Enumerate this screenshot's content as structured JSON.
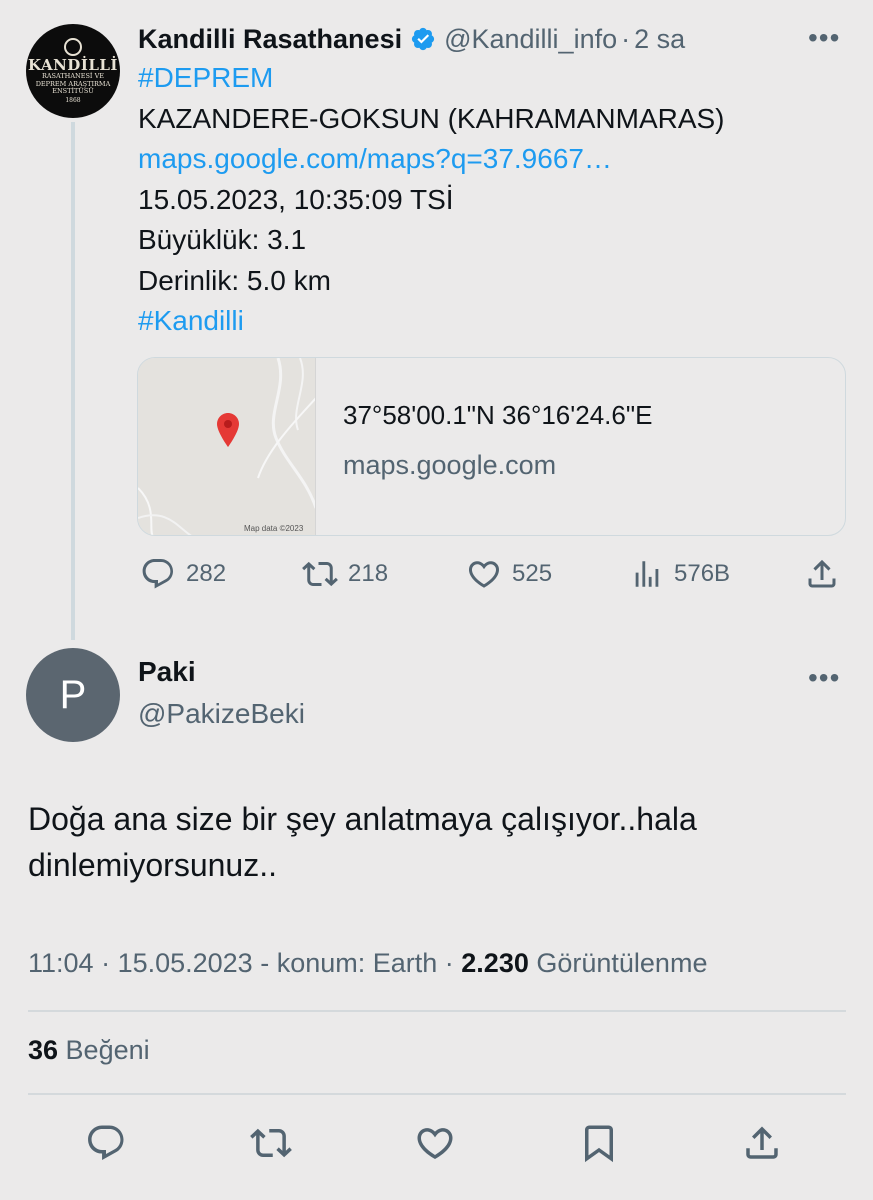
{
  "parent_tweet": {
    "author_name": "Kandilli Rasathanesi",
    "author_handle": "@Kandilli_info",
    "separator": "·",
    "time_ago": "2 sa",
    "more": "•••",
    "avatar": {
      "brand": "KANDİLLİ",
      "line1": "RASATHANESİ VE",
      "line2": "DEPREM ARAŞTIRMA",
      "line3": "ENSTİTÜSÜ",
      "year": "1868"
    },
    "lines": {
      "hashtag1": "#DEPREM",
      "location": "KAZANDERE-GOKSUN (KAHRAMANMARAS)",
      "link": "maps.google.com/maps?q=37.9667…",
      "datetime": "15.05.2023, 10:35:09 TSİ",
      "magnitude": "Büyüklük: 3.1",
      "depth": "Derinlik: 5.0 km",
      "hashtag2": "#Kandilli"
    },
    "card": {
      "coords": "37°58'00.1\"N 36°16'24.6\"E",
      "domain": "maps.google.com",
      "map_attribution": "Map data ©2023"
    },
    "actions": {
      "replies": "282",
      "retweets": "218",
      "likes": "525",
      "views": "576B"
    },
    "colors": {
      "link": "#1d9bf0",
      "verified": "#1d9bf0",
      "map_pin": "#e53935"
    }
  },
  "reply_tweet": {
    "avatar_letter": "P",
    "author_name": "Paki",
    "author_handle": "@PakizeBeki",
    "more": "•••",
    "text_line1": "Doğa ana size bir şey anlatmaya çalışıyor..hala",
    "text_line2": "dinlemiyorsunuz..",
    "meta": {
      "time": "11:04",
      "sep": " · ",
      "date": "15.05.2023",
      "location": " - konum: Earth",
      "views_count": "2.230",
      "views_label": " Görüntülenme"
    },
    "likes_count": "36",
    "likes_label": " Beğeni"
  },
  "icons": [
    "reply-icon",
    "retweet-icon",
    "like-icon",
    "views-icon",
    "share-icon",
    "bookmark-icon",
    "verified-badge-icon",
    "map-pin-icon",
    "more-icon"
  ]
}
